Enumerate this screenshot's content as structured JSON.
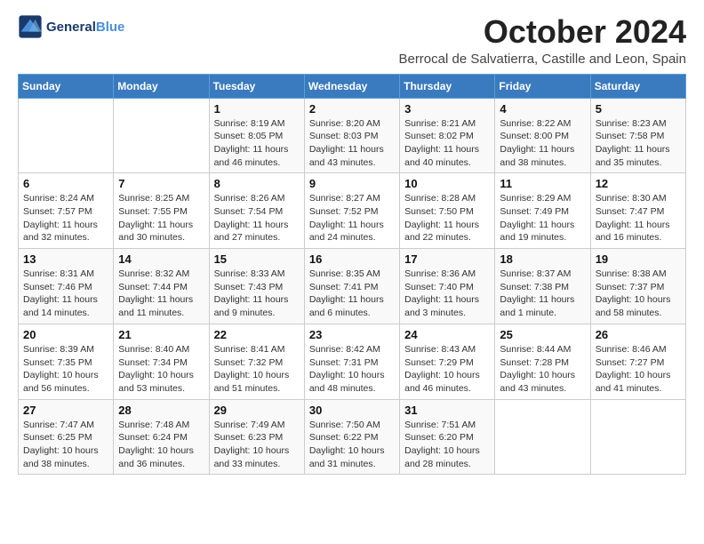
{
  "logo": {
    "line1": "General",
    "line2": "Blue"
  },
  "title": "October 2024",
  "subtitle": "Berrocal de Salvatierra, Castille and Leon, Spain",
  "weekdays": [
    "Sunday",
    "Monday",
    "Tuesday",
    "Wednesday",
    "Thursday",
    "Friday",
    "Saturday"
  ],
  "weeks": [
    [
      {
        "day": "",
        "detail": ""
      },
      {
        "day": "",
        "detail": ""
      },
      {
        "day": "1",
        "detail": "Sunrise: 8:19 AM\nSunset: 8:05 PM\nDaylight: 11 hours and 46 minutes."
      },
      {
        "day": "2",
        "detail": "Sunrise: 8:20 AM\nSunset: 8:03 PM\nDaylight: 11 hours and 43 minutes."
      },
      {
        "day": "3",
        "detail": "Sunrise: 8:21 AM\nSunset: 8:02 PM\nDaylight: 11 hours and 40 minutes."
      },
      {
        "day": "4",
        "detail": "Sunrise: 8:22 AM\nSunset: 8:00 PM\nDaylight: 11 hours and 38 minutes."
      },
      {
        "day": "5",
        "detail": "Sunrise: 8:23 AM\nSunset: 7:58 PM\nDaylight: 11 hours and 35 minutes."
      }
    ],
    [
      {
        "day": "6",
        "detail": "Sunrise: 8:24 AM\nSunset: 7:57 PM\nDaylight: 11 hours and 32 minutes."
      },
      {
        "day": "7",
        "detail": "Sunrise: 8:25 AM\nSunset: 7:55 PM\nDaylight: 11 hours and 30 minutes."
      },
      {
        "day": "8",
        "detail": "Sunrise: 8:26 AM\nSunset: 7:54 PM\nDaylight: 11 hours and 27 minutes."
      },
      {
        "day": "9",
        "detail": "Sunrise: 8:27 AM\nSunset: 7:52 PM\nDaylight: 11 hours and 24 minutes."
      },
      {
        "day": "10",
        "detail": "Sunrise: 8:28 AM\nSunset: 7:50 PM\nDaylight: 11 hours and 22 minutes."
      },
      {
        "day": "11",
        "detail": "Sunrise: 8:29 AM\nSunset: 7:49 PM\nDaylight: 11 hours and 19 minutes."
      },
      {
        "day": "12",
        "detail": "Sunrise: 8:30 AM\nSunset: 7:47 PM\nDaylight: 11 hours and 16 minutes."
      }
    ],
    [
      {
        "day": "13",
        "detail": "Sunrise: 8:31 AM\nSunset: 7:46 PM\nDaylight: 11 hours and 14 minutes."
      },
      {
        "day": "14",
        "detail": "Sunrise: 8:32 AM\nSunset: 7:44 PM\nDaylight: 11 hours and 11 minutes."
      },
      {
        "day": "15",
        "detail": "Sunrise: 8:33 AM\nSunset: 7:43 PM\nDaylight: 11 hours and 9 minutes."
      },
      {
        "day": "16",
        "detail": "Sunrise: 8:35 AM\nSunset: 7:41 PM\nDaylight: 11 hours and 6 minutes."
      },
      {
        "day": "17",
        "detail": "Sunrise: 8:36 AM\nSunset: 7:40 PM\nDaylight: 11 hours and 3 minutes."
      },
      {
        "day": "18",
        "detail": "Sunrise: 8:37 AM\nSunset: 7:38 PM\nDaylight: 11 hours and 1 minute."
      },
      {
        "day": "19",
        "detail": "Sunrise: 8:38 AM\nSunset: 7:37 PM\nDaylight: 10 hours and 58 minutes."
      }
    ],
    [
      {
        "day": "20",
        "detail": "Sunrise: 8:39 AM\nSunset: 7:35 PM\nDaylight: 10 hours and 56 minutes."
      },
      {
        "day": "21",
        "detail": "Sunrise: 8:40 AM\nSunset: 7:34 PM\nDaylight: 10 hours and 53 minutes."
      },
      {
        "day": "22",
        "detail": "Sunrise: 8:41 AM\nSunset: 7:32 PM\nDaylight: 10 hours and 51 minutes."
      },
      {
        "day": "23",
        "detail": "Sunrise: 8:42 AM\nSunset: 7:31 PM\nDaylight: 10 hours and 48 minutes."
      },
      {
        "day": "24",
        "detail": "Sunrise: 8:43 AM\nSunset: 7:29 PM\nDaylight: 10 hours and 46 minutes."
      },
      {
        "day": "25",
        "detail": "Sunrise: 8:44 AM\nSunset: 7:28 PM\nDaylight: 10 hours and 43 minutes."
      },
      {
        "day": "26",
        "detail": "Sunrise: 8:46 AM\nSunset: 7:27 PM\nDaylight: 10 hours and 41 minutes."
      }
    ],
    [
      {
        "day": "27",
        "detail": "Sunrise: 7:47 AM\nSunset: 6:25 PM\nDaylight: 10 hours and 38 minutes."
      },
      {
        "day": "28",
        "detail": "Sunrise: 7:48 AM\nSunset: 6:24 PM\nDaylight: 10 hours and 36 minutes."
      },
      {
        "day": "29",
        "detail": "Sunrise: 7:49 AM\nSunset: 6:23 PM\nDaylight: 10 hours and 33 minutes."
      },
      {
        "day": "30",
        "detail": "Sunrise: 7:50 AM\nSunset: 6:22 PM\nDaylight: 10 hours and 31 minutes."
      },
      {
        "day": "31",
        "detail": "Sunrise: 7:51 AM\nSunset: 6:20 PM\nDaylight: 10 hours and 28 minutes."
      },
      {
        "day": "",
        "detail": ""
      },
      {
        "day": "",
        "detail": ""
      }
    ]
  ]
}
